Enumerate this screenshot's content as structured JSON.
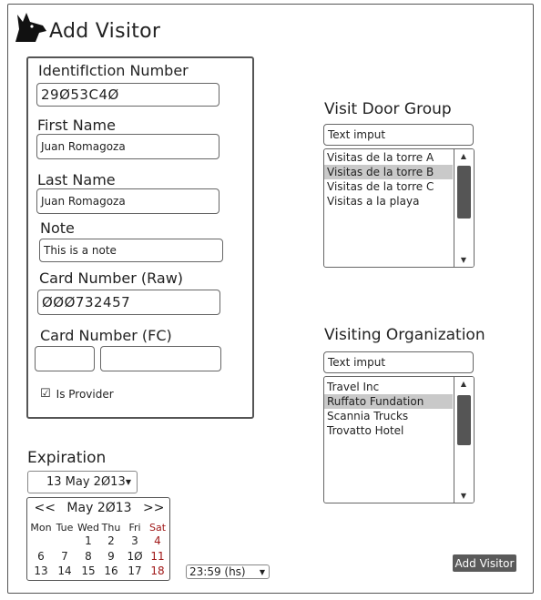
{
  "page": {
    "title": "Add Visitor",
    "logo_icon": "dog-head-icon"
  },
  "form": {
    "id_label": "IdentifIction Number",
    "id_value": "29Ø53C4Ø",
    "first_name_label": "First Name",
    "first_name_value": "Juan Romagoza",
    "last_name_label": "Last Name",
    "last_name_value": "Juan Romagoza",
    "note_label": "Note",
    "note_value": "This is a note",
    "card_raw_label": "Card Number (Raw)",
    "card_raw_value": "ØØØ732457",
    "card_fc_label": "Card Number (FC)",
    "card_fc_value_1": "",
    "card_fc_value_2": "",
    "is_provider_label": "Is Provider",
    "is_provider_checked": true
  },
  "door_group": {
    "label": "Visit Door Group",
    "filter_placeholder": "Text imput",
    "items": [
      "Visitas de la torre A",
      "Visitas de la torre B",
      "Visitas de la torre C",
      "Visitas a la playa"
    ],
    "selected_index": 1
  },
  "organization": {
    "label": "Visiting Organization",
    "filter_placeholder": "Text imput",
    "items": [
      "Travel Inc",
      "Ruffato Fundation",
      "Scannia Trucks",
      "Trovatto Hotel"
    ],
    "selected_index": 1
  },
  "expiration": {
    "label": "Expiration",
    "date_value": "13 May 2Ø13",
    "calendar": {
      "prev": "<<",
      "month_year": "May 2Ø13",
      "next": ">>",
      "weekdays": [
        "Mon",
        "Tue",
        "Wed",
        "Thu",
        "Fri",
        "Sat"
      ],
      "rows": [
        [
          "",
          "",
          "1",
          "2",
          "3",
          "4"
        ],
        [
          "6",
          "7",
          "8",
          "9",
          "1Ø",
          "11"
        ],
        [
          "13",
          "14",
          "15",
          "16",
          "17",
          "18"
        ]
      ]
    },
    "time_value": "23:59 (hs)"
  },
  "actions": {
    "add_label": "Add Visitor"
  },
  "colors": {
    "accent_red": "#a01818",
    "button_bg": "#5a5a5a",
    "selection": "#c9c9c9"
  }
}
